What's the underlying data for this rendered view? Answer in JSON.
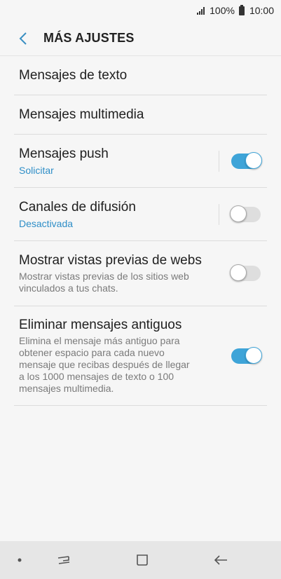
{
  "status_bar": {
    "battery_percent": "100%",
    "time": "10:00",
    "icons": [
      "signal-icon",
      "battery-icon"
    ]
  },
  "header": {
    "title": "MÁS AJUSTES",
    "back_icon": "chevron-left-icon"
  },
  "settings": [
    {
      "title": "Mensajes de texto"
    },
    {
      "title": "Mensajes multimedia"
    },
    {
      "title": "Mensajes push",
      "subtitle": "Solicitar",
      "toggle": true
    },
    {
      "title": "Canales de difusión",
      "subtitle": "Desactivada",
      "toggle": false
    },
    {
      "title": "Mostrar vistas previas de webs",
      "description": "Mostrar vistas previas de los sitios web vinculados a tus chats.",
      "toggle": false
    },
    {
      "title": "Eliminar mensajes antiguos",
      "description": "Elimina el mensaje más antiguo para obtener espacio para cada nuevo mensaje que recibas después de llegar a los 1000 mensajes de texto o 100 mensajes multimedia.",
      "toggle": true
    }
  ],
  "nav_bar": {
    "icons": [
      "dot-icon",
      "recents-icon",
      "home-icon",
      "back-arrow-icon"
    ]
  },
  "colors": {
    "accent": "#3ea4d8",
    "subtitle_accent": "#2e8ec7",
    "background": "#f6f6f6",
    "nav_background": "#e6e6e6"
  }
}
